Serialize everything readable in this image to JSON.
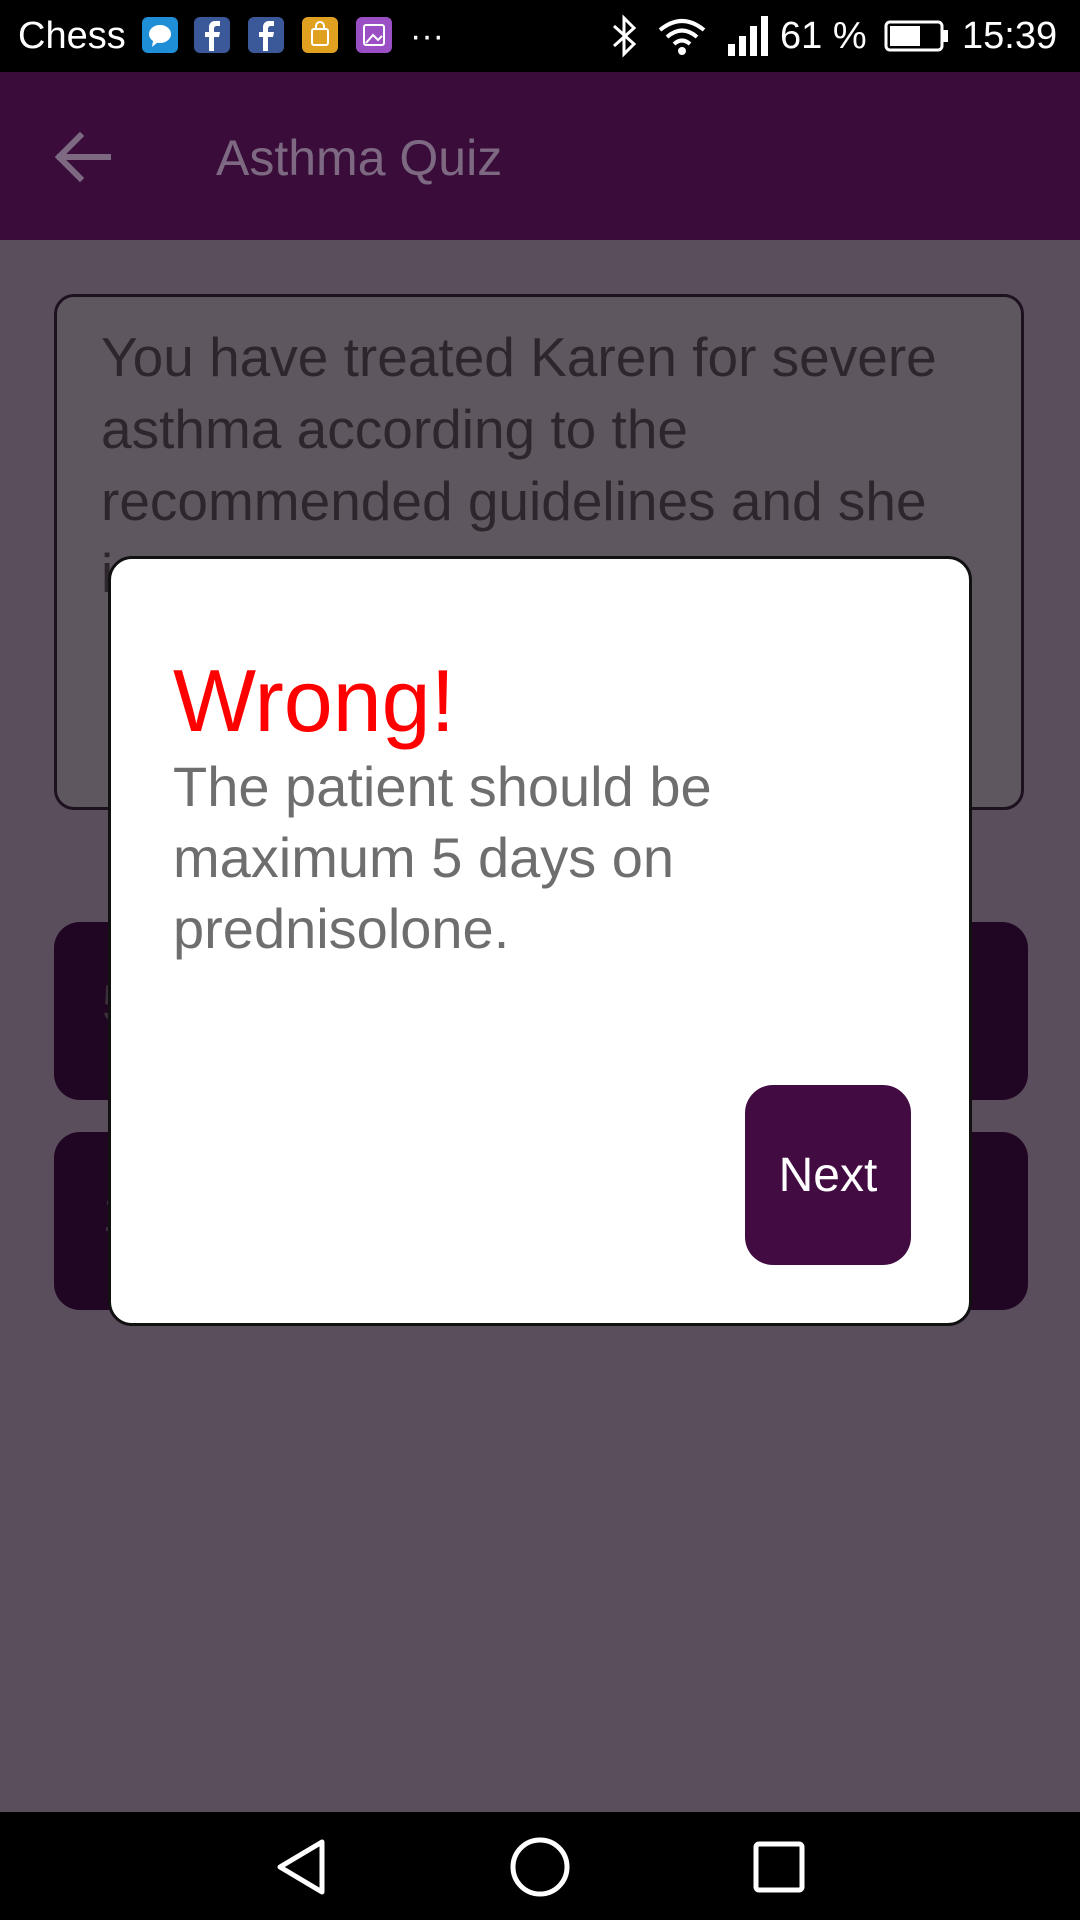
{
  "status_bar": {
    "app_name": "Chess",
    "notification_icons": [
      "messenger-icon",
      "facebook-icon",
      "facebook-icon",
      "shopping-bag-icon",
      "gallery-icon"
    ],
    "more_indicator": "···",
    "battery_percent": "61 %",
    "time": "15:39"
  },
  "app_bar": {
    "title": "Asthma Quiz",
    "color": "#3a0c3a"
  },
  "question": {
    "text": "You have treated Karen for severe asthma according to the recommended guidelines and she is now"
  },
  "answers": [
    {
      "label": "5"
    },
    {
      "label": "1"
    }
  ],
  "dialog": {
    "title": "Wrong!",
    "message": "The patient should be maximum 5 days on prednisolone.",
    "next_label": "Next",
    "title_color": "#ff0000",
    "button_color": "#420c43"
  }
}
